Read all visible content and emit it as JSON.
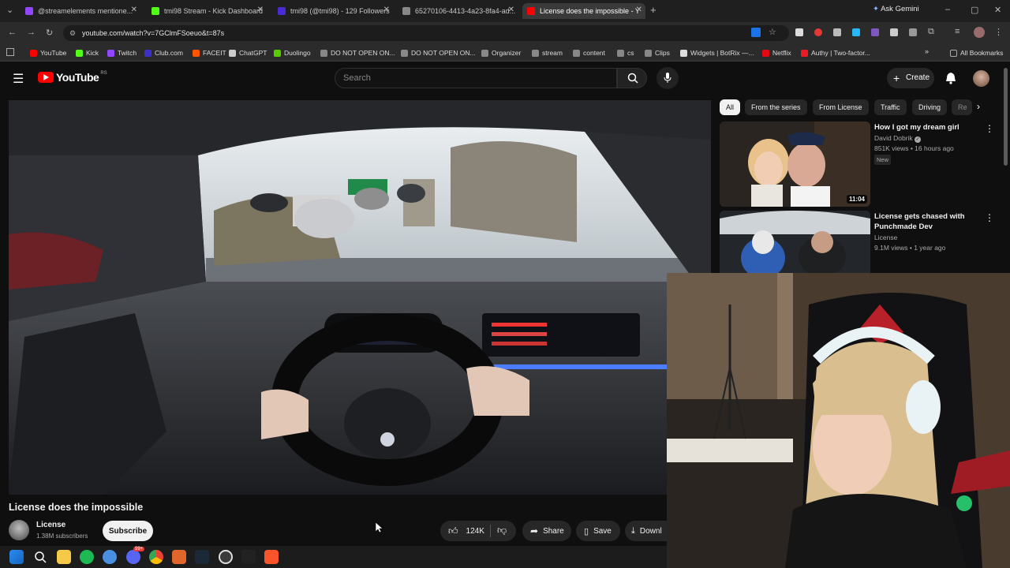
{
  "browser": {
    "tabs": [
      {
        "label": "@streamelements mentione...",
        "color": "#9146ff"
      },
      {
        "label": "tmi98 Stream - Kick Dashboard",
        "color": "#53fc18"
      },
      {
        "label": "tmi98 (@tmi98) - 129 Followers",
        "color": "#4a2bd6"
      },
      {
        "label": "65270106-4413-4a23-8fa4-ad...",
        "color": "#888888"
      },
      {
        "label": "License does the impossible - Y",
        "color": "#ff0000"
      }
    ],
    "ask_gemini": "Ask Gemini",
    "url": "youtube.com/watch?v=7GClmFSoeuo&t=87s",
    "bookmarks": [
      {
        "label": "YouTube",
        "color": "#ff0000"
      },
      {
        "label": "Kick",
        "color": "#53fc18"
      },
      {
        "label": "Twitch",
        "color": "#9146ff"
      },
      {
        "label": "Club.com",
        "color": "#3b30c8"
      },
      {
        "label": "FACEIT",
        "color": "#ff5500"
      },
      {
        "label": "ChatGPT",
        "color": "#cccccc"
      },
      {
        "label": "Duolingo",
        "color": "#58cc02"
      },
      {
        "label": "DO NOT OPEN ON...",
        "color": "#888888"
      },
      {
        "label": "DO NOT OPEN ON...",
        "color": "#888888"
      },
      {
        "label": "Organizer",
        "color": "#888888"
      },
      {
        "label": "stream",
        "color": "#888888"
      },
      {
        "label": "content",
        "color": "#888888"
      },
      {
        "label": "cs",
        "color": "#888888"
      },
      {
        "label": "Clips",
        "color": "#888888"
      },
      {
        "label": "Widgets | BotRix —...",
        "color": "#dddddd"
      },
      {
        "label": "Netflix",
        "color": "#e50914"
      },
      {
        "label": "Authy | Two-factor...",
        "color": "#ec1c24"
      }
    ],
    "all_bookmarks": "All Bookmarks"
  },
  "youtube": {
    "logo_text": "YouTube",
    "logo_region": "RS",
    "search_placeholder": "Search",
    "create_label": "Create",
    "chips": [
      "All",
      "From the series",
      "From License",
      "Traffic",
      "Driving",
      "Re"
    ],
    "recommendations": [
      {
        "title": "How I got my dream girl",
        "channel": "David Dobrik",
        "meta": "851K views • 16 hours ago",
        "badge": "New",
        "duration": "11:04"
      },
      {
        "title": "License gets chased with Punchmade Dev",
        "channel": "License",
        "meta": "9.1M views • 1 year ago"
      }
    ],
    "video": {
      "title": "License does the impossible",
      "channel": "License",
      "subscribers": "1.38M subscribers",
      "subscribe_label": "Subscribe",
      "likes": "124K",
      "share_label": "Share",
      "save_label": "Save",
      "download_label": "Downl"
    }
  },
  "taskbar": {
    "apps": [
      "windows-start",
      "search",
      "file-explorer",
      "spotify",
      "app-blue",
      "discord",
      "chrome",
      "app-shield",
      "steam",
      "obs",
      "capcut",
      "brave"
    ],
    "discord_badge": "99+"
  }
}
